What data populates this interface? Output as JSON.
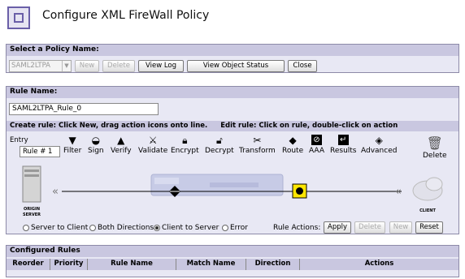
{
  "page": {
    "title": "Configure XML FireWall Policy"
  },
  "policy": {
    "header": "Select a Policy Name:",
    "selected": "SAML2LTPA",
    "buttons": {
      "new": "New",
      "delete": "Delete",
      "view_log": "View Log",
      "view_object_status": "View Object Status",
      "close": "Close"
    }
  },
  "rule": {
    "header": "Rule Name:",
    "name_value": "SAML2LTPA_Rule_0",
    "create_hint": "Create rule: Click New, drag action icons onto line.",
    "edit_hint": "Edit rule: Click on rule, double-click on action",
    "entry_label": "Entry",
    "rule_number": "Rule # 1",
    "tools": [
      "Filter",
      "Sign",
      "Verify",
      "Validate",
      "Encrypt",
      "Decrypt",
      "Transform",
      "Route",
      "AAA",
      "Results",
      "Advanced"
    ],
    "delete_label": "Delete",
    "origin_label_1": "ORIGIN",
    "origin_label_2": "SERVER",
    "client_label": "CLIENT",
    "directions": [
      "Server to Client",
      "Both Directions",
      "Client to Server",
      "Error"
    ],
    "selected_direction": "Client to Server",
    "actions_label": "Rule Actions:",
    "action_buttons": {
      "apply": "Apply",
      "delete": "Delete",
      "new": "New",
      "reset": "Reset"
    }
  },
  "configured": {
    "header": "Configured Rules",
    "columns": [
      "Reorder",
      "Priority",
      "Rule Name",
      "Match Name",
      "Direction",
      "Actions"
    ]
  }
}
